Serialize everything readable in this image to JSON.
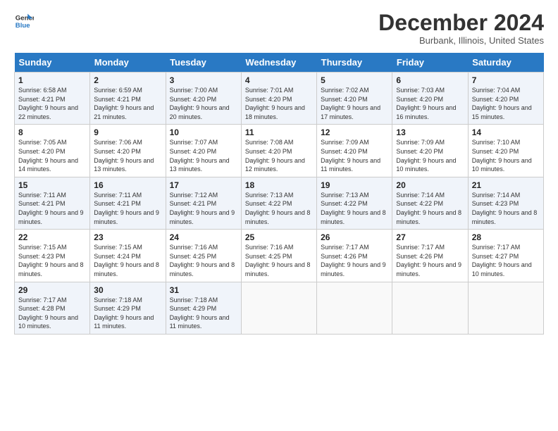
{
  "header": {
    "logo_line1": "General",
    "logo_line2": "Blue",
    "month": "December 2024",
    "location": "Burbank, Illinois, United States"
  },
  "days_of_week": [
    "Sunday",
    "Monday",
    "Tuesday",
    "Wednesday",
    "Thursday",
    "Friday",
    "Saturday"
  ],
  "weeks": [
    [
      {
        "day": "1",
        "sunrise": "6:58 AM",
        "sunset": "4:21 PM",
        "daylight": "9 hours and 22 minutes."
      },
      {
        "day": "2",
        "sunrise": "6:59 AM",
        "sunset": "4:21 PM",
        "daylight": "9 hours and 21 minutes."
      },
      {
        "day": "3",
        "sunrise": "7:00 AM",
        "sunset": "4:20 PM",
        "daylight": "9 hours and 20 minutes."
      },
      {
        "day": "4",
        "sunrise": "7:01 AM",
        "sunset": "4:20 PM",
        "daylight": "9 hours and 18 minutes."
      },
      {
        "day": "5",
        "sunrise": "7:02 AM",
        "sunset": "4:20 PM",
        "daylight": "9 hours and 17 minutes."
      },
      {
        "day": "6",
        "sunrise": "7:03 AM",
        "sunset": "4:20 PM",
        "daylight": "9 hours and 16 minutes."
      },
      {
        "day": "7",
        "sunrise": "7:04 AM",
        "sunset": "4:20 PM",
        "daylight": "9 hours and 15 minutes."
      }
    ],
    [
      {
        "day": "8",
        "sunrise": "7:05 AM",
        "sunset": "4:20 PM",
        "daylight": "9 hours and 14 minutes."
      },
      {
        "day": "9",
        "sunrise": "7:06 AM",
        "sunset": "4:20 PM",
        "daylight": "9 hours and 13 minutes."
      },
      {
        "day": "10",
        "sunrise": "7:07 AM",
        "sunset": "4:20 PM",
        "daylight": "9 hours and 13 minutes."
      },
      {
        "day": "11",
        "sunrise": "7:08 AM",
        "sunset": "4:20 PM",
        "daylight": "9 hours and 12 minutes."
      },
      {
        "day": "12",
        "sunrise": "7:09 AM",
        "sunset": "4:20 PM",
        "daylight": "9 hours and 11 minutes."
      },
      {
        "day": "13",
        "sunrise": "7:09 AM",
        "sunset": "4:20 PM",
        "daylight": "9 hours and 10 minutes."
      },
      {
        "day": "14",
        "sunrise": "7:10 AM",
        "sunset": "4:20 PM",
        "daylight": "9 hours and 10 minutes."
      }
    ],
    [
      {
        "day": "15",
        "sunrise": "7:11 AM",
        "sunset": "4:21 PM",
        "daylight": "9 hours and 9 minutes."
      },
      {
        "day": "16",
        "sunrise": "7:11 AM",
        "sunset": "4:21 PM",
        "daylight": "9 hours and 9 minutes."
      },
      {
        "day": "17",
        "sunrise": "7:12 AM",
        "sunset": "4:21 PM",
        "daylight": "9 hours and 9 minutes."
      },
      {
        "day": "18",
        "sunrise": "7:13 AM",
        "sunset": "4:22 PM",
        "daylight": "9 hours and 8 minutes."
      },
      {
        "day": "19",
        "sunrise": "7:13 AM",
        "sunset": "4:22 PM",
        "daylight": "9 hours and 8 minutes."
      },
      {
        "day": "20",
        "sunrise": "7:14 AM",
        "sunset": "4:22 PM",
        "daylight": "9 hours and 8 minutes."
      },
      {
        "day": "21",
        "sunrise": "7:14 AM",
        "sunset": "4:23 PM",
        "daylight": "9 hours and 8 minutes."
      }
    ],
    [
      {
        "day": "22",
        "sunrise": "7:15 AM",
        "sunset": "4:23 PM",
        "daylight": "9 hours and 8 minutes."
      },
      {
        "day": "23",
        "sunrise": "7:15 AM",
        "sunset": "4:24 PM",
        "daylight": "9 hours and 8 minutes."
      },
      {
        "day": "24",
        "sunrise": "7:16 AM",
        "sunset": "4:25 PM",
        "daylight": "9 hours and 8 minutes."
      },
      {
        "day": "25",
        "sunrise": "7:16 AM",
        "sunset": "4:25 PM",
        "daylight": "9 hours and 8 minutes."
      },
      {
        "day": "26",
        "sunrise": "7:17 AM",
        "sunset": "4:26 PM",
        "daylight": "9 hours and 9 minutes."
      },
      {
        "day": "27",
        "sunrise": "7:17 AM",
        "sunset": "4:26 PM",
        "daylight": "9 hours and 9 minutes."
      },
      {
        "day": "28",
        "sunrise": "7:17 AM",
        "sunset": "4:27 PM",
        "daylight": "9 hours and 10 minutes."
      }
    ],
    [
      {
        "day": "29",
        "sunrise": "7:17 AM",
        "sunset": "4:28 PM",
        "daylight": "9 hours and 10 minutes."
      },
      {
        "day": "30",
        "sunrise": "7:18 AM",
        "sunset": "4:29 PM",
        "daylight": "9 hours and 11 minutes."
      },
      {
        "day": "31",
        "sunrise": "7:18 AM",
        "sunset": "4:29 PM",
        "daylight": "9 hours and 11 minutes."
      },
      null,
      null,
      null,
      null
    ]
  ]
}
